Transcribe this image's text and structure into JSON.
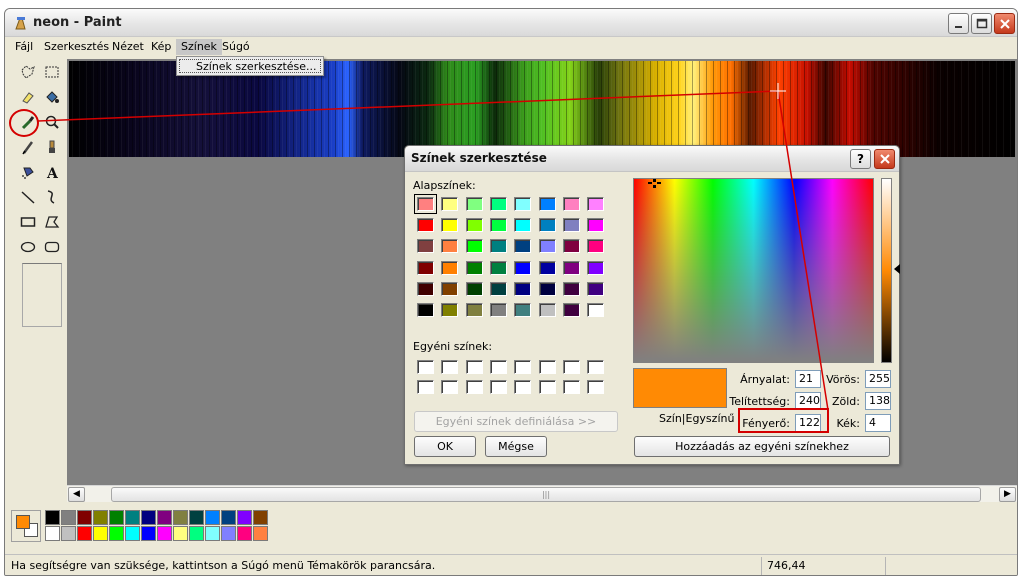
{
  "window": {
    "title": "neon - Paint"
  },
  "menubar": {
    "items": [
      "Fájl",
      "Szerkesztés",
      "Nézet",
      "Kép",
      "Színek",
      "Súgó"
    ]
  },
  "dropdown": {
    "item": "Színek szerkesztése..."
  },
  "statusbar": {
    "help": "Ha segítségre van szüksége, kattintson a Súgó menü Témakörök parancsára.",
    "coords": "746,44"
  },
  "current_colors": {
    "foreground": "#ff8a04",
    "background": "#ffffff"
  },
  "palette_top": [
    "#000000",
    "#808080",
    "#800000",
    "#808000",
    "#008000",
    "#008080",
    "#000080",
    "#800080",
    "#808040",
    "#004040",
    "#0080ff",
    "#004080",
    "#8000ff",
    "#804000"
  ],
  "palette_bottom": [
    "#ffffff",
    "#c0c0c0",
    "#ff0000",
    "#ffff00",
    "#00ff00",
    "#00ffff",
    "#0000ff",
    "#ff00ff",
    "#ffff80",
    "#00ff80",
    "#80ffff",
    "#8080ff",
    "#ff0080",
    "#ff8040"
  ],
  "dialog": {
    "title": "Színek szerkesztése",
    "help_button": "?",
    "basic_colors_label": "Alapszínek:",
    "basic_colors": [
      [
        "#ff8080",
        "#ffff80",
        "#80ff80",
        "#00ff80",
        "#80ffff",
        "#0080ff",
        "#ff80c0",
        "#ff80ff"
      ],
      [
        "#ff0000",
        "#ffff00",
        "#80ff00",
        "#00ff40",
        "#00ffff",
        "#0080c0",
        "#8080c0",
        "#ff00ff"
      ],
      [
        "#804040",
        "#ff8040",
        "#00ff00",
        "#008080",
        "#004080",
        "#8080ff",
        "#800040",
        "#ff0080"
      ],
      [
        "#800000",
        "#ff8000",
        "#008000",
        "#008040",
        "#0000ff",
        "#0000a0",
        "#800080",
        "#8000ff"
      ],
      [
        "#400000",
        "#804000",
        "#004000",
        "#004040",
        "#000080",
        "#000040",
        "#400040",
        "#400080"
      ],
      [
        "#000000",
        "#808000",
        "#808040",
        "#808080",
        "#408080",
        "#c0c0c0",
        "#400040",
        "#ffffff"
      ]
    ],
    "custom_colors_label": "Egyéni színek:",
    "define_button": "Egyéni színek definiálása >>",
    "ok_button": "OK",
    "cancel_button": "Mégse",
    "preview_label": "Szín|Egyszínű",
    "preview_color": "#ff8a04",
    "hue_label": "Árnyalat:",
    "hue": "21",
    "sat_label": "Telítettség:",
    "sat": "240",
    "lum_label": "Fényerő:",
    "lum": "122",
    "red_label": "Vörös:",
    "red": "255",
    "green_label": "Zöld:",
    "green": "138",
    "blue_label": "Kék:",
    "blue": "4",
    "add_button": "Hozzáadás az egyéni színekhez"
  }
}
